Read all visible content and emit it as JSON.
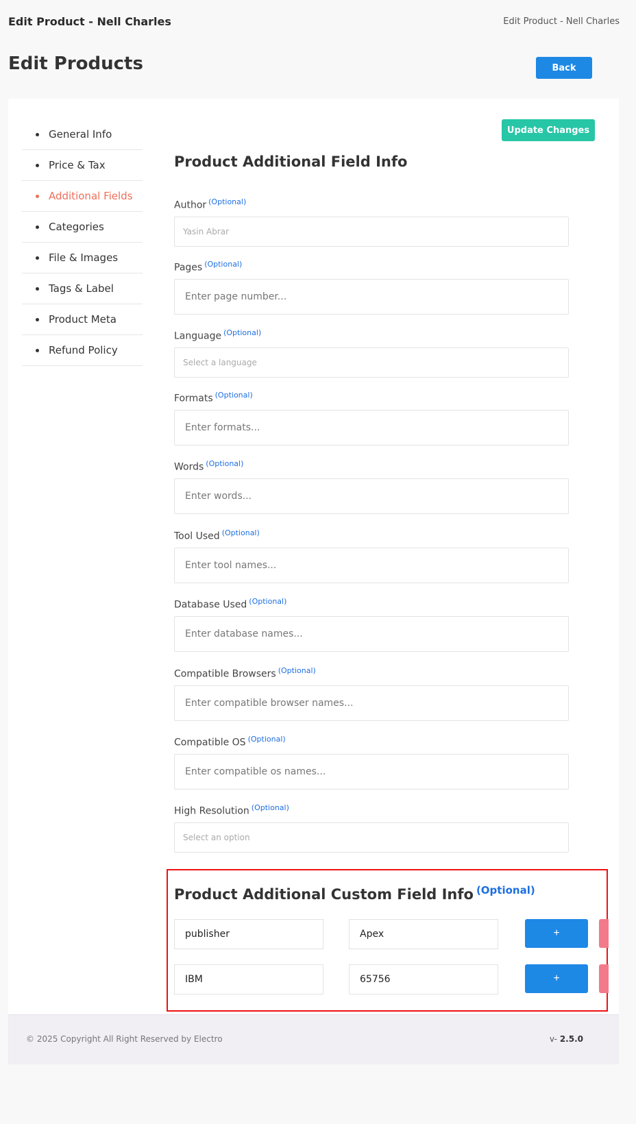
{
  "topbar": {
    "title": "Edit Product - Nell Charles",
    "breadcrumb": "Edit Product - Nell Charles"
  },
  "page": {
    "title": "Edit Products",
    "back_label": "Back"
  },
  "sidebar": {
    "items": [
      {
        "label": "General Info",
        "active": false
      },
      {
        "label": "Price & Tax",
        "active": false
      },
      {
        "label": "Additional Fields",
        "active": true
      },
      {
        "label": "Categories",
        "active": false
      },
      {
        "label": "File & Images",
        "active": false
      },
      {
        "label": "Tags & Label",
        "active": false
      },
      {
        "label": "Product Meta",
        "active": false
      },
      {
        "label": "Refund Policy",
        "active": false
      }
    ]
  },
  "form": {
    "update_label": "Update Changes",
    "section_title": "Product Additional Field Info",
    "optional_tag": "(Optional)",
    "author": {
      "label": "Author",
      "value": "Yasin Abrar"
    },
    "pages": {
      "label": "Pages",
      "placeholder": "Enter page number..."
    },
    "language": {
      "label": "Language",
      "value": "Select a language"
    },
    "formats": {
      "label": "Formats",
      "placeholder": "Enter formats..."
    },
    "words": {
      "label": "Words",
      "placeholder": "Enter words..."
    },
    "tool_used": {
      "label": "Tool Used",
      "placeholder": "Enter tool names..."
    },
    "database_used": {
      "label": "Database Used",
      "placeholder": "Enter database names..."
    },
    "compatible_browsers": {
      "label": "Compatible Browsers",
      "placeholder": "Enter compatible browser names..."
    },
    "compatible_os": {
      "label": "Compatible OS",
      "placeholder": "Enter compatible os names..."
    },
    "high_resolution": {
      "label": "High Resolution",
      "value": "Select an option"
    }
  },
  "custom": {
    "title": "Product Additional Custom Field Info",
    "optional_tag": "(Optional)",
    "add_label": "+",
    "rows": [
      {
        "key": "publisher",
        "value": "Apex"
      },
      {
        "key": "IBM",
        "value": "65756"
      }
    ]
  },
  "footer": {
    "copyright": "© 2025 Copyright All Right Reserved by Electro",
    "version_prefix": "v-",
    "version": "2.5.0"
  },
  "colors": {
    "primary": "#1e88e5",
    "success": "#26c6a6",
    "active": "#ef6f5b",
    "danger": "#f27a8a",
    "highlight": "#ee1111"
  }
}
